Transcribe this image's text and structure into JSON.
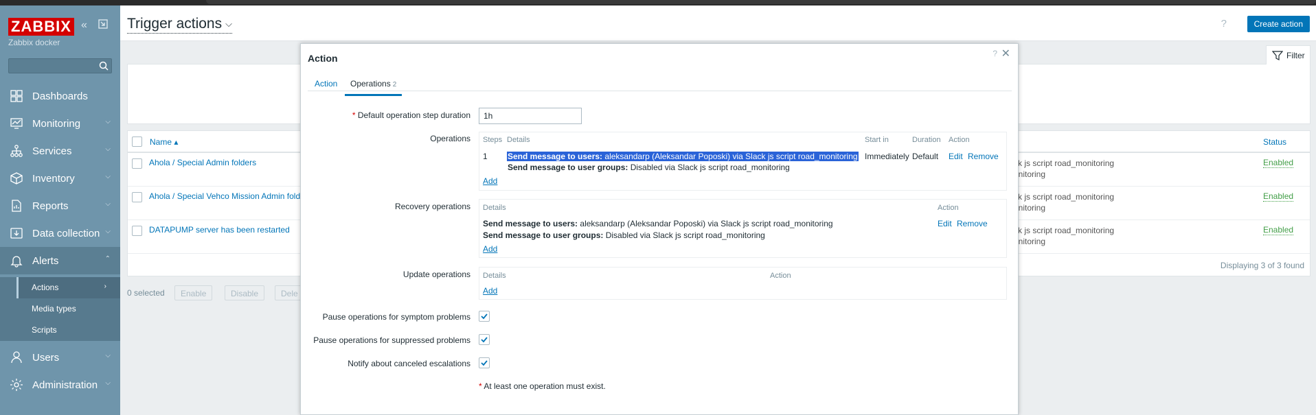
{
  "app": {
    "logo": "ZABBIX",
    "server_name": "Zabbix docker"
  },
  "nav": {
    "items": [
      {
        "label": "Dashboards",
        "icon": "dashboard-icon"
      },
      {
        "label": "Monitoring",
        "icon": "monitor-icon"
      },
      {
        "label": "Services",
        "icon": "services-icon"
      },
      {
        "label": "Inventory",
        "icon": "inventory-icon"
      },
      {
        "label": "Reports",
        "icon": "reports-icon"
      },
      {
        "label": "Data collection",
        "icon": "data-collection-icon"
      },
      {
        "label": "Alerts",
        "icon": "bell-icon"
      },
      {
        "label": "Users",
        "icon": "users-icon"
      },
      {
        "label": "Administration",
        "icon": "gear-icon"
      }
    ],
    "alerts_sub": [
      "Actions",
      "Media types",
      "Scripts"
    ]
  },
  "header": {
    "title": "Trigger actions",
    "create_label": "Create action",
    "filter_label": "Filter",
    "help": "?"
  },
  "table": {
    "col_name": "Name ▴",
    "col_status": "Status",
    "rows": [
      {
        "name": "Ahola / Special Admin folders",
        "ops1": "ck js script road_monitoring",
        "ops2": "onitoring",
        "status": "Enabled"
      },
      {
        "name": "Ahola / Special Vehco Mission Admin fold",
        "ops1": "ck js script road_monitoring",
        "ops2": "onitoring",
        "status": "Enabled"
      },
      {
        "name": "DATAPUMP server has been restarted",
        "ops1": "ck js script road_monitoring",
        "ops2": "onitoring",
        "status": "Enabled"
      }
    ],
    "count": "Displaying 3 of 3 found",
    "selected": "0 selected",
    "btn_enable": "Enable",
    "btn_disable": "Disable",
    "btn_delete": "Dele"
  },
  "modal": {
    "title": "Action",
    "help": "?",
    "close": "✕",
    "tabs": {
      "action": "Action",
      "operations": "Operations",
      "operations_count": "2"
    },
    "step_duration_label": "Default operation step duration",
    "step_duration_value": "1h",
    "operations_label": "Operations",
    "ops_headers": {
      "steps": "Steps",
      "details": "Details",
      "start_in": "Start in",
      "duration": "Duration",
      "action": "Action"
    },
    "ops_row": {
      "step": "1",
      "line1_bold": "Send message to users:",
      "line1_rest": " aleksandarp (Aleksandar Poposki) via Slack js script road_monitoring",
      "line2_bold": "Send message to user groups:",
      "line2_rest": " Disabled via Slack js script road_monitoring",
      "start_in": "Immediately",
      "duration": "Default",
      "edit": "Edit",
      "remove": "Remove"
    },
    "add": "Add",
    "recovery_label": "Recovery operations",
    "rec_headers": {
      "details": "Details",
      "action": "Action"
    },
    "rec_row": {
      "line1_bold": "Send message to users:",
      "line1_rest": " aleksandarp (Aleksandar Poposki) via Slack js script road_monitoring",
      "line2_bold": "Send message to user groups:",
      "line2_rest": " Disabled via Slack js script road_monitoring",
      "edit": "Edit",
      "remove": "Remove"
    },
    "update_label": "Update operations",
    "upd_headers": {
      "details": "Details",
      "action": "Action"
    },
    "pause_symptom_label": "Pause operations for symptom problems",
    "pause_suppressed_label": "Pause operations for suppressed problems",
    "notify_canceled_label": "Notify about canceled escalations",
    "note": "At least one operation must exist."
  }
}
